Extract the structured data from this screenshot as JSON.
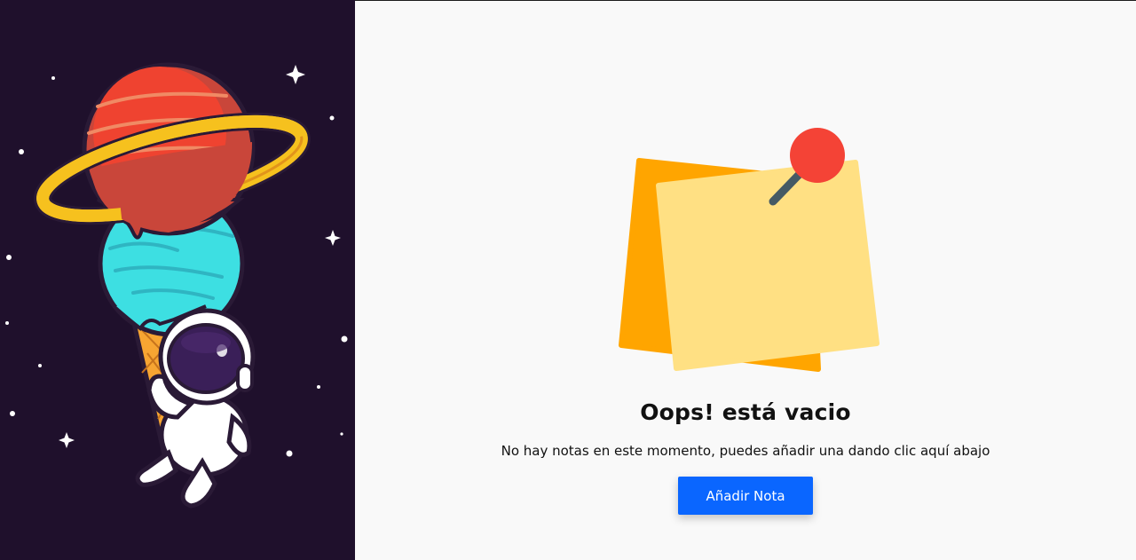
{
  "empty_state": {
    "title": "Oops! está vacio",
    "description": "No hay notas en este momento, puedes añadir una dando clic aquí abajo",
    "button_label": "Añadir Nota"
  },
  "colors": {
    "left_background": "#1f102c",
    "page_background": "#f9f9f9",
    "button_background": "#0a66ff",
    "note_back": "#ffa500",
    "note_front": "#ffe083",
    "pin_head": "#f44336"
  },
  "icons": {
    "illustration_left": "astronaut-ice-cream-planet",
    "illustration_right": "sticky-notes-pin"
  }
}
